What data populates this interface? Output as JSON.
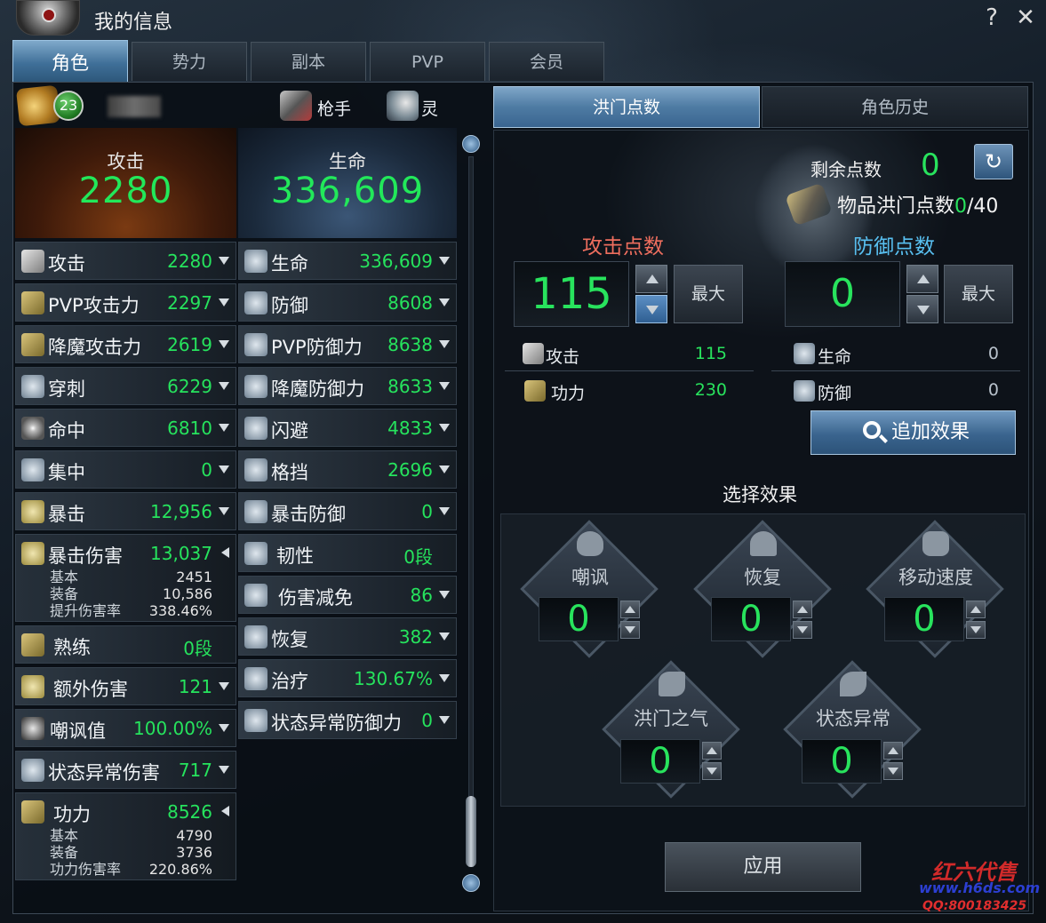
{
  "window": {
    "title": "我的信息",
    "help": "?",
    "close": "✕"
  },
  "tabs": [
    "角色",
    "势力",
    "副本",
    "PVP",
    "会员"
  ],
  "character": {
    "level": "23",
    "class_label": "枪手",
    "element_label": "灵"
  },
  "summary": {
    "attack_title": "攻击",
    "attack_value": "2280",
    "hp_title": "生命",
    "hp_value": "336,609"
  },
  "left_stats": [
    {
      "label": "攻击",
      "value": "2280"
    },
    {
      "label": "PVP攻击力",
      "value": "2297"
    },
    {
      "label": "降魔攻击力",
      "value": "2619"
    },
    {
      "label": "穿刺",
      "value": "6229"
    },
    {
      "label": "命中",
      "value": "6810"
    },
    {
      "label": "集中",
      "value": "0"
    },
    {
      "label": "暴击",
      "value": "12,956"
    },
    {
      "label": "暴击伤害",
      "value": "13,037",
      "details": [
        {
          "k": "基本",
          "v": "2451"
        },
        {
          "k": "装备",
          "v": "10,586"
        },
        {
          "k": "提升伤害率",
          "v": "338.46%"
        }
      ]
    },
    {
      "label": "熟练",
      "value": "0段"
    },
    {
      "label": "额外伤害",
      "value": "121"
    },
    {
      "label": "嘲讽值",
      "value": "100.00%"
    },
    {
      "label": "状态异常伤害",
      "value": "717"
    },
    {
      "label": "功力",
      "value": "8526",
      "details": [
        {
          "k": "基本",
          "v": "4790"
        },
        {
          "k": "装备",
          "v": "3736"
        },
        {
          "k": "功力伤害率",
          "v": "220.86%"
        }
      ]
    }
  ],
  "right_stats": [
    {
      "label": "生命",
      "value": "336,609"
    },
    {
      "label": "防御",
      "value": "8608"
    },
    {
      "label": "PVP防御力",
      "value": "8638"
    },
    {
      "label": "降魔防御力",
      "value": "8633"
    },
    {
      "label": "闪避",
      "value": "4833"
    },
    {
      "label": "格挡",
      "value": "2696"
    },
    {
      "label": "暴击防御",
      "value": "0"
    },
    {
      "label": "韧性",
      "value": "0段"
    },
    {
      "label": "伤害减免",
      "value": "86"
    },
    {
      "label": "恢复",
      "value": "382"
    },
    {
      "label": "治疗",
      "value": "130.67%"
    },
    {
      "label": "状态异常防御力",
      "value": "0"
    }
  ],
  "right_tabs": [
    "洪门点数",
    "角色历史"
  ],
  "points": {
    "remain_label": "剩余点数",
    "remain_value": "0",
    "item_label": "物品洪门点数",
    "item_current": "0",
    "item_max": "/40",
    "attack_title": "攻击点数",
    "attack_value": "115",
    "defense_title": "防御点数",
    "defense_value": "0",
    "max_label": "最大",
    "attack_effects": [
      {
        "label": "攻击",
        "value": "115"
      },
      {
        "label": "功力",
        "value": "230"
      }
    ],
    "defense_effects": [
      {
        "label": "生命",
        "value": "0"
      },
      {
        "label": "防御",
        "value": "0"
      }
    ],
    "add_effect": "追加效果"
  },
  "select": {
    "title": "选择效果",
    "items": [
      {
        "label": "嘲讽",
        "value": "0"
      },
      {
        "label": "恢复",
        "value": "0"
      },
      {
        "label": "移动速度",
        "value": "0"
      },
      {
        "label": "洪门之气",
        "value": "0"
      },
      {
        "label": "状态异常",
        "value": "0"
      }
    ],
    "apply": "应用"
  },
  "watermark": {
    "line1": "红六代售",
    "line2": "www.h6ds.com",
    "line3": "QQ:800183425"
  }
}
